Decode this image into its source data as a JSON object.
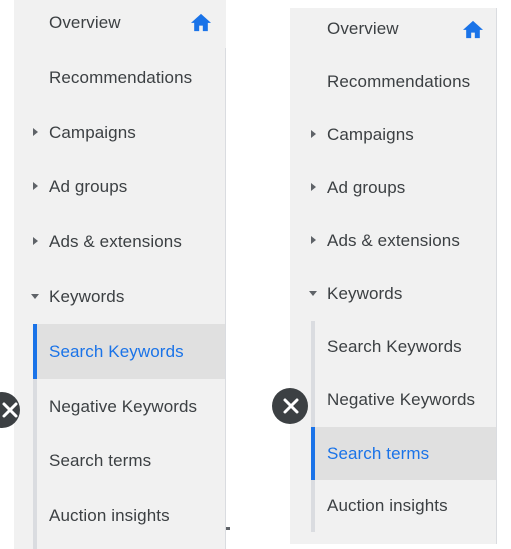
{
  "panels": {
    "before": {
      "items": [
        {
          "label": "Overview"
        },
        {
          "label": "Recommendations"
        },
        {
          "label": "Campaigns"
        },
        {
          "label": "Ad groups"
        },
        {
          "label": "Ads & extensions"
        },
        {
          "label": "Keywords"
        },
        {
          "label": "Search Keywords"
        },
        {
          "label": "Negative Keywords"
        },
        {
          "label": "Search terms"
        },
        {
          "label": "Auction insights"
        }
      ],
      "active_item": "Search Keywords"
    },
    "after": {
      "items": [
        {
          "label": "Overview"
        },
        {
          "label": "Recommendations"
        },
        {
          "label": "Campaigns"
        },
        {
          "label": "Ad groups"
        },
        {
          "label": "Ads & extensions"
        },
        {
          "label": "Keywords"
        },
        {
          "label": "Search Keywords"
        },
        {
          "label": "Negative Keywords"
        },
        {
          "label": "Search terms"
        },
        {
          "label": "Auction insights"
        }
      ],
      "active_item": "Search terms"
    }
  },
  "icons": {
    "home": "home-icon",
    "collapsed": "chevron-right-icon",
    "expanded": "chevron-down-icon",
    "close": "close-icon"
  },
  "colors": {
    "accent": "#1a73e8",
    "text": "#3c4043",
    "panel_bg": "#f1f1f1",
    "active_bg": "#e0e0e0",
    "rail": "#dadce0"
  }
}
